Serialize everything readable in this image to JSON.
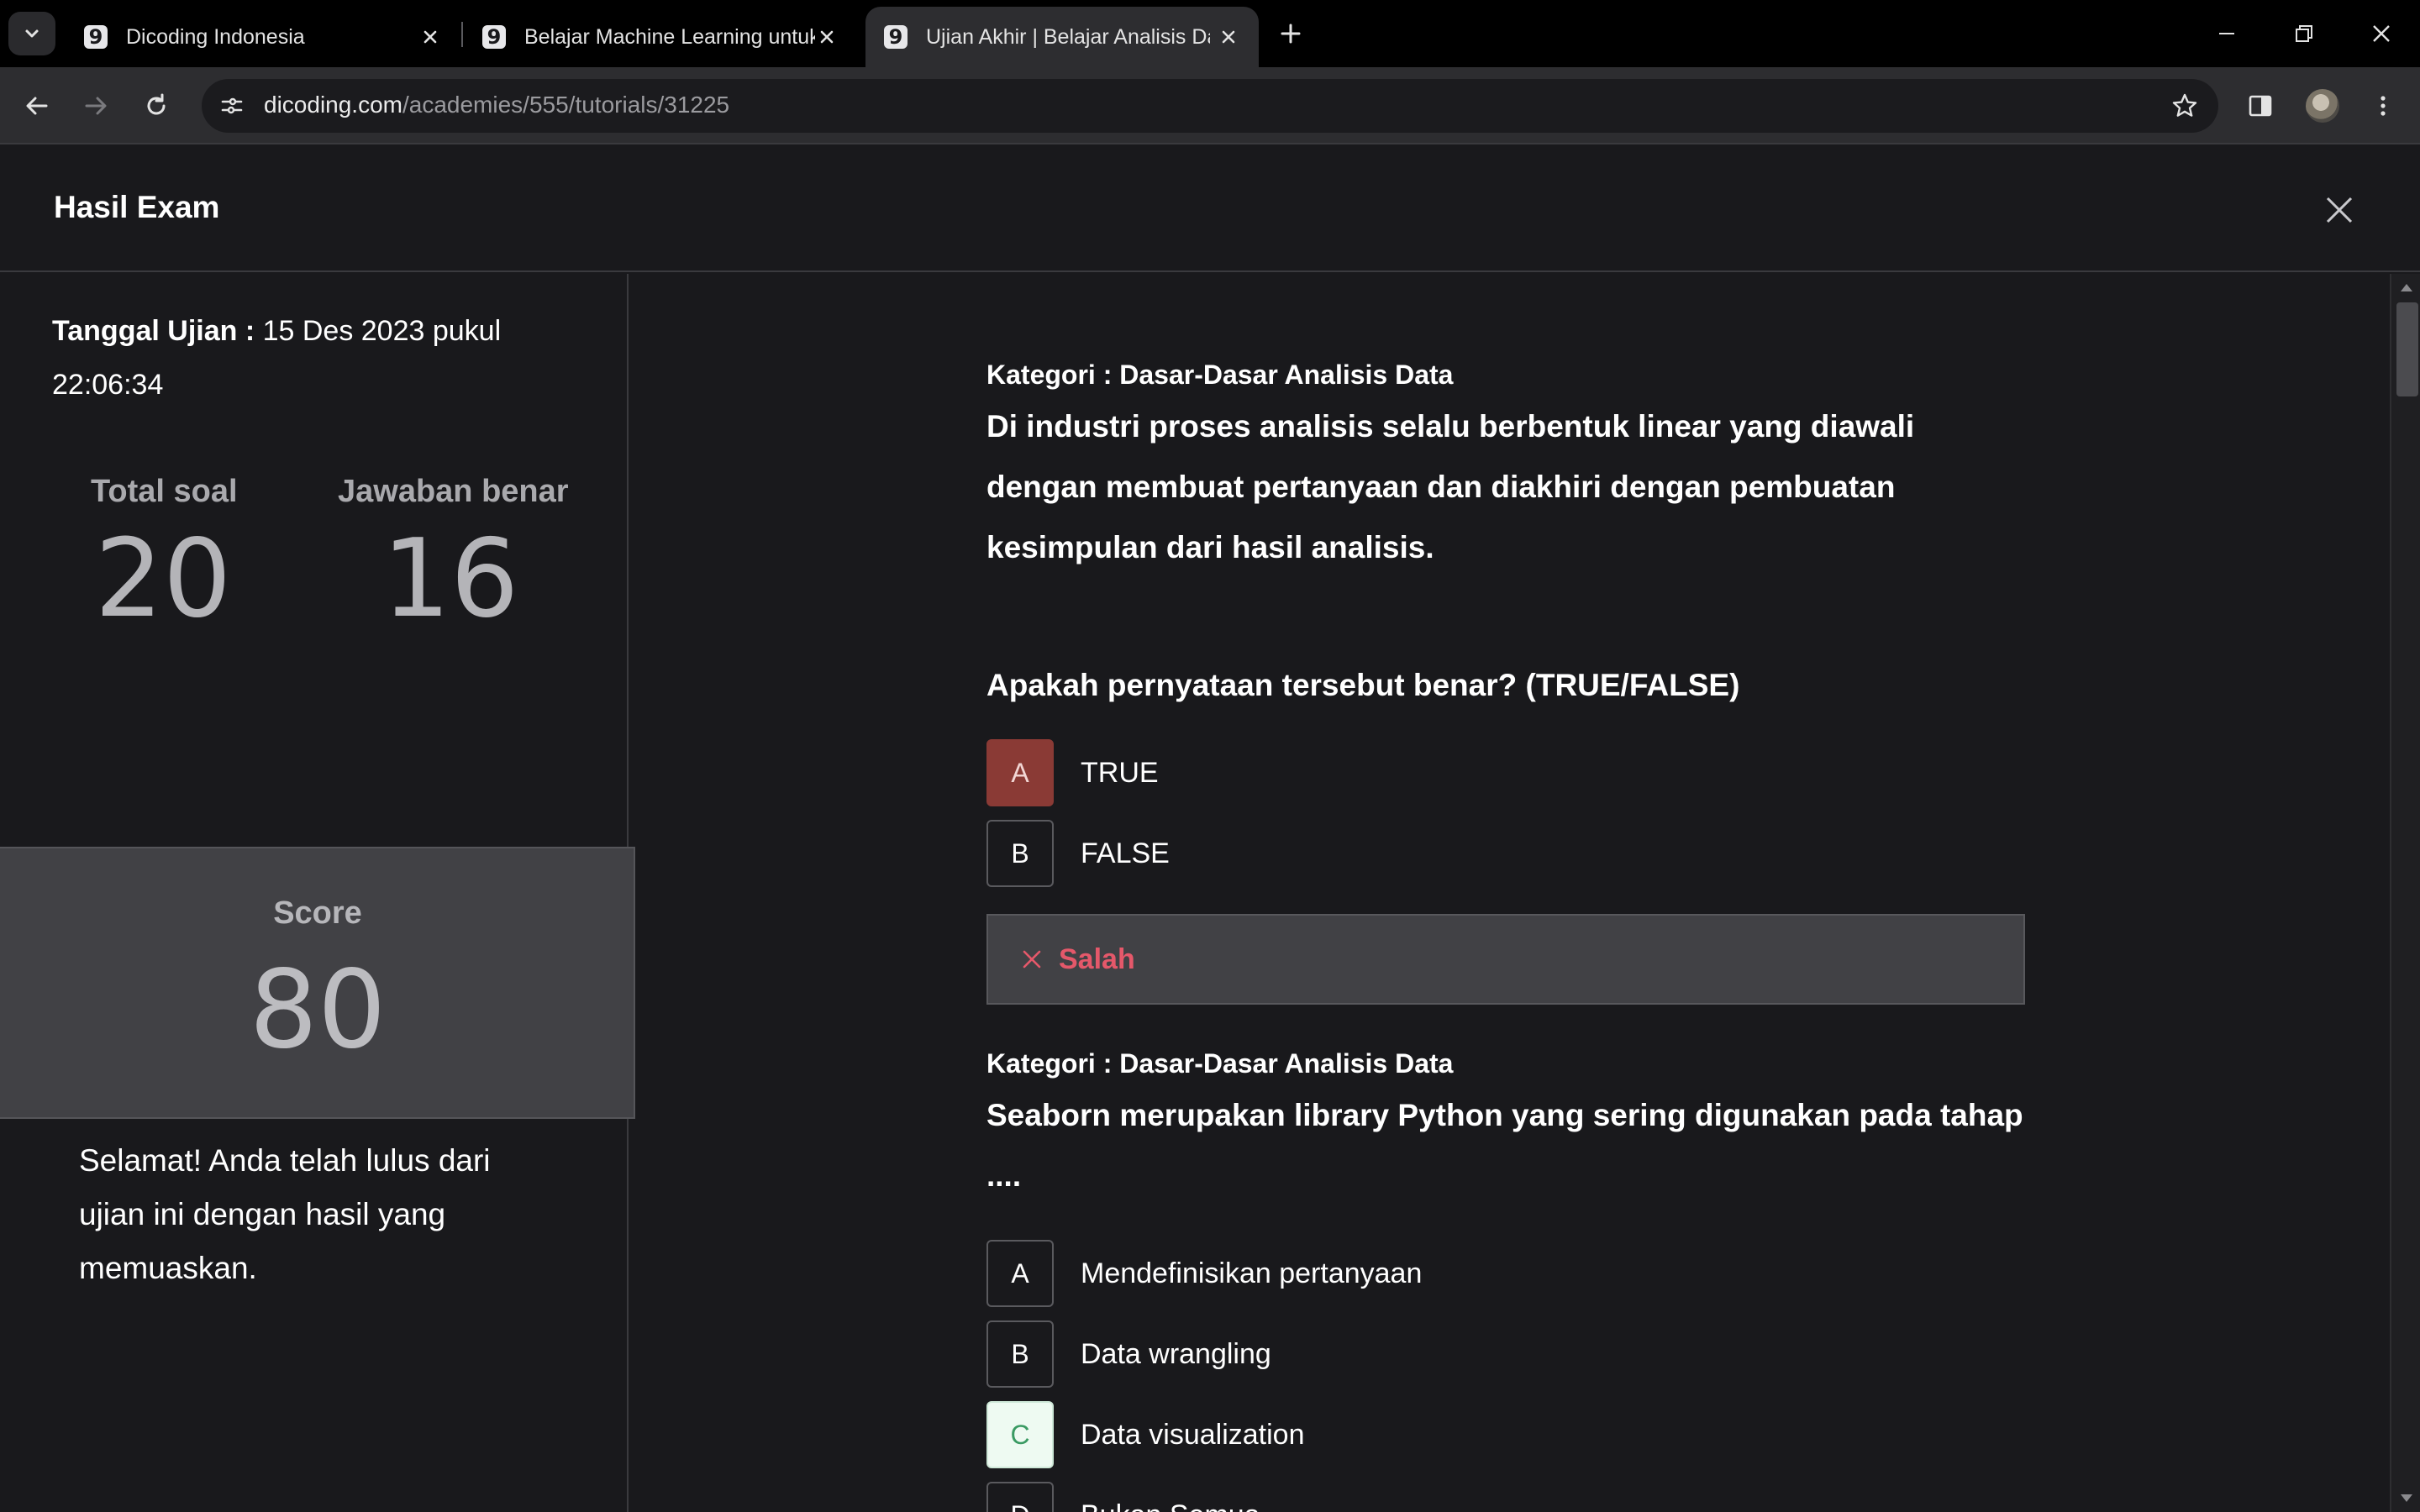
{
  "browser": {
    "tabs": [
      {
        "title": "Dicoding Indonesia",
        "favicon": "dicoding-logo"
      },
      {
        "title": "Belajar Machine Learning untuk",
        "favicon": "dicoding-logo"
      },
      {
        "title": "Ujian Akhir | Belajar Analisis Dat",
        "favicon": "dicoding-logo"
      }
    ],
    "favicon_glyph": "9",
    "url": {
      "host": "dicoding.com",
      "path": "/academies/555/tutorials/31225"
    }
  },
  "page": {
    "title": "Hasil Exam"
  },
  "sidebar": {
    "exam_date_label": "Tanggal Ujian :",
    "exam_date_value": " 15 Des 2023 pukul 22:06:34",
    "total_label": "Total soal",
    "total_value": "20",
    "correct_label": "Jawaban benar",
    "correct_value": "16",
    "score_label": "Score",
    "score_value": "80",
    "message": "Selamat! Anda telah lulus dari ujian ini dengan hasil yang memuaskan."
  },
  "questions": [
    {
      "category": "Kategori : Dasar-Dasar Analisis Data",
      "text": "Di industri proses analisis selalu berbentuk linear yang diawali dengan membuat pertanyaan dan diakhiri dengan pembuatan kesimpulan dari hasil analisis.",
      "prompt": "Apakah pernyataan tersebut benar? (TRUE/FALSE)",
      "options": [
        {
          "letter": "A",
          "text": "TRUE"
        },
        {
          "letter": "B",
          "text": "FALSE"
        }
      ],
      "result": "Salah"
    },
    {
      "category": "Kategori : Dasar-Dasar Analisis Data",
      "text": "Seaborn merupakan library Python yang sering digunakan pada tahap ....",
      "options": [
        {
          "letter": "A",
          "text": "Mendefinisikan pertanyaan"
        },
        {
          "letter": "B",
          "text": "Data wrangling"
        },
        {
          "letter": "C",
          "text": "Data visualization"
        },
        {
          "letter": "D",
          "text": "Bukan Semua"
        }
      ]
    }
  ],
  "colors": {
    "wrong_answer": "#8a3a35",
    "correct_answer": "#eefaf2",
    "wrong_result_text": "#e5586a"
  }
}
